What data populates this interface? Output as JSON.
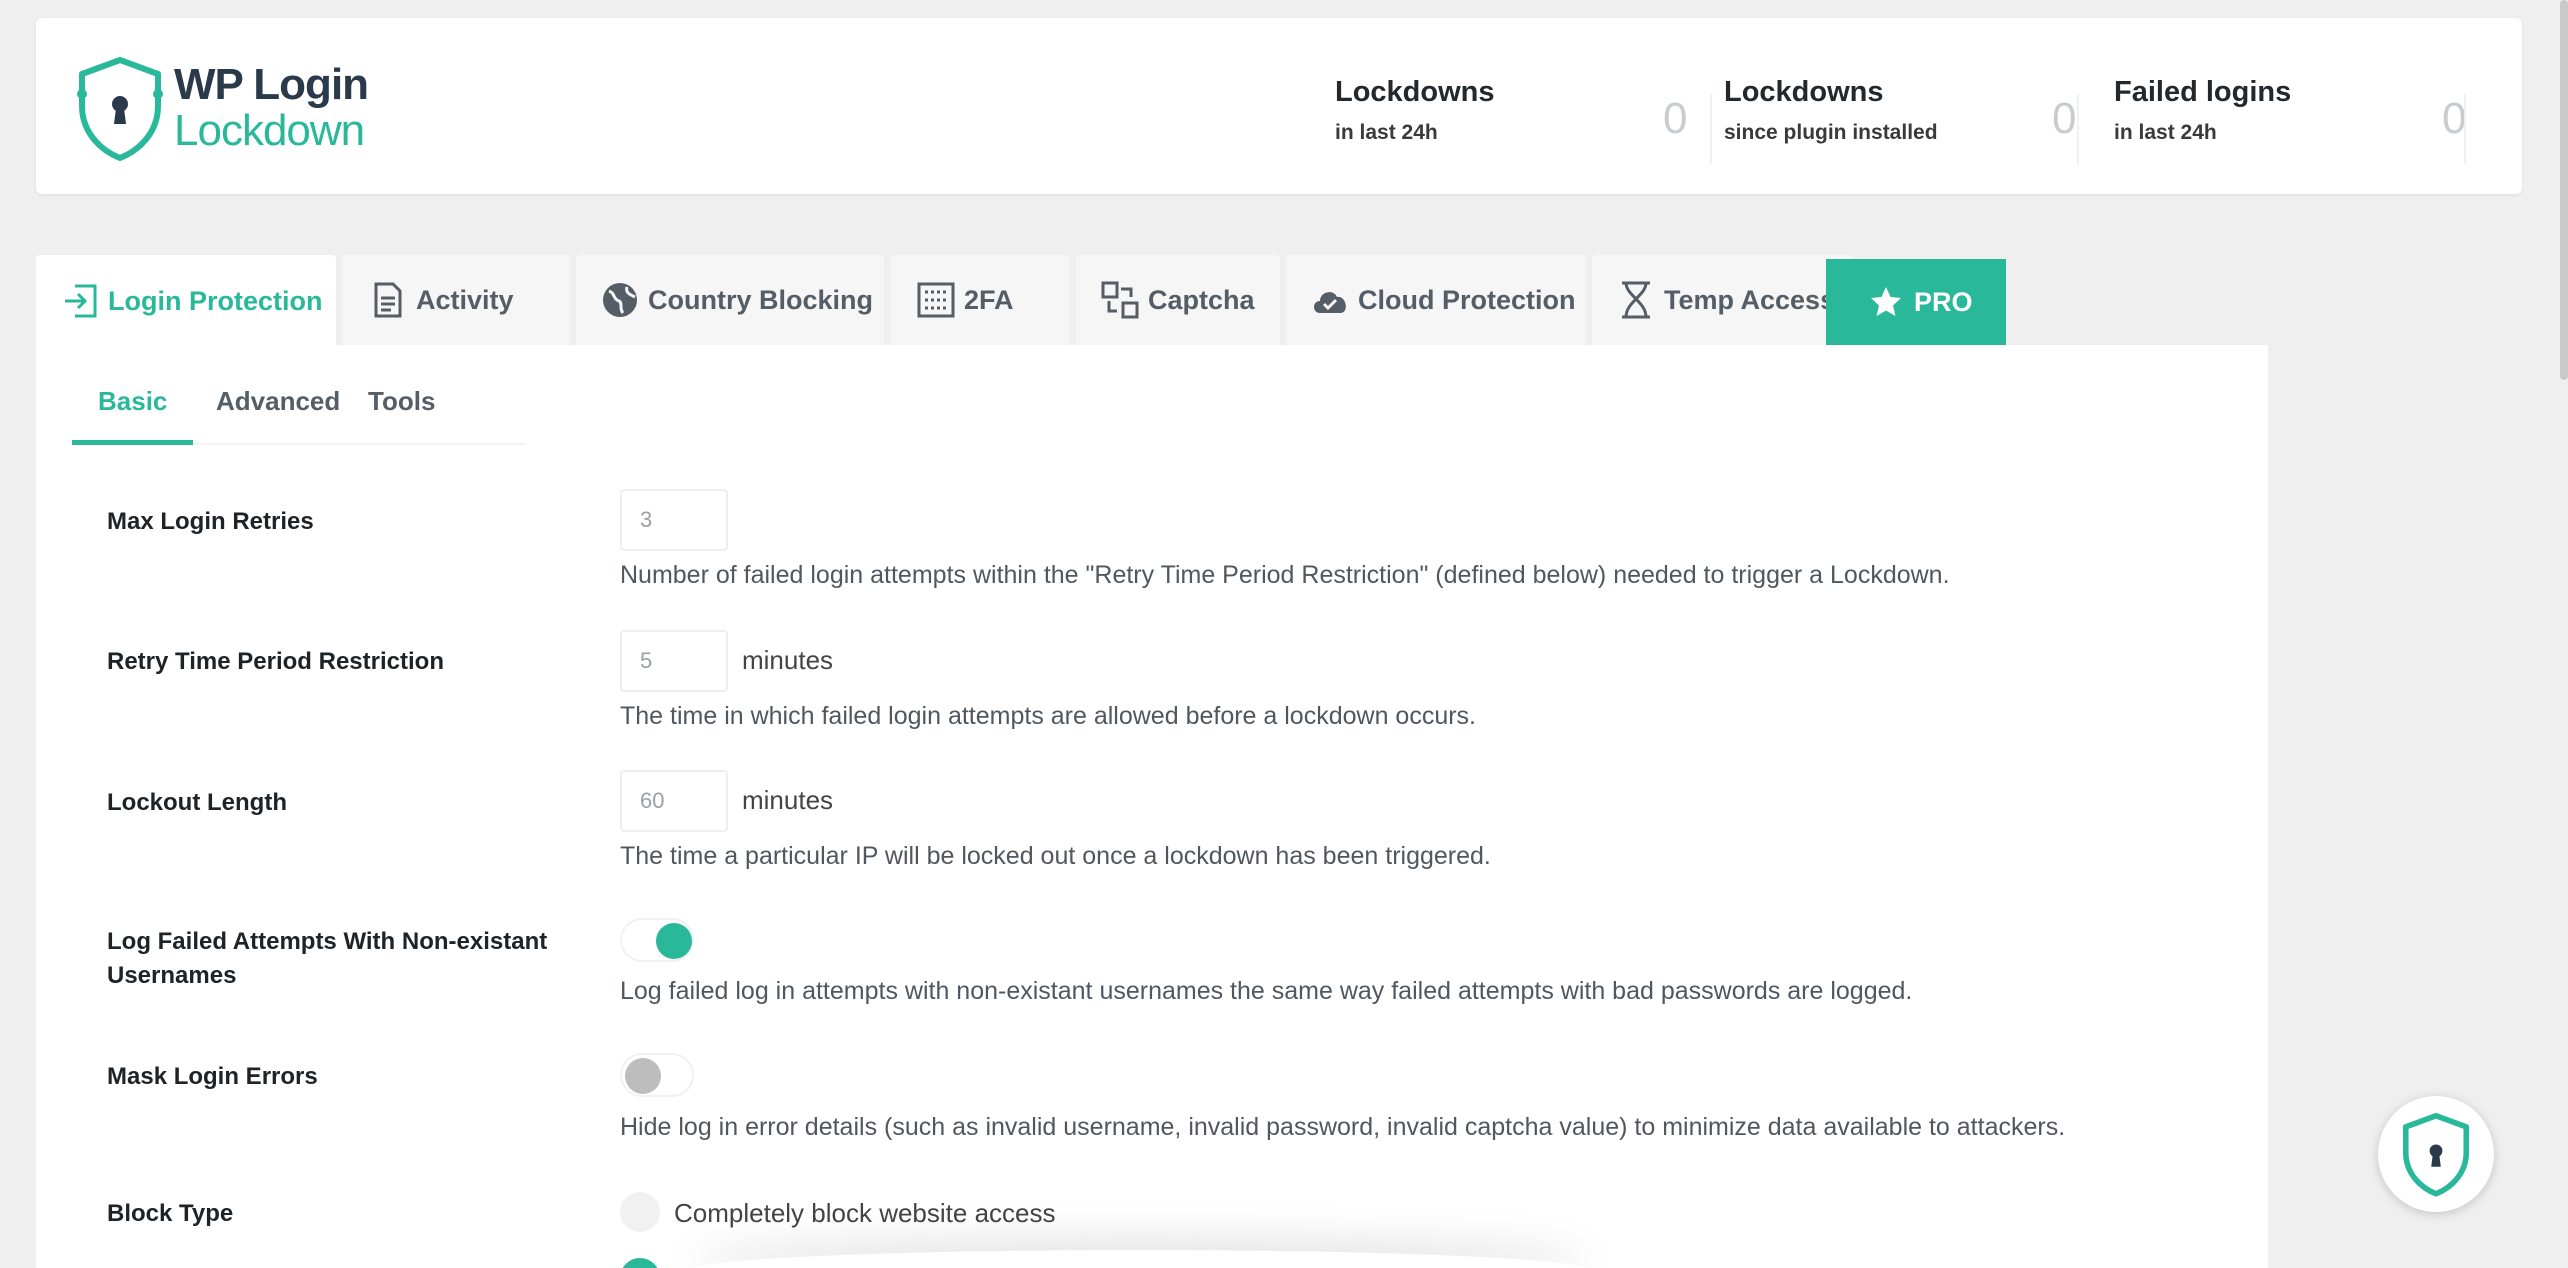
{
  "brand": {
    "line1": "WP Login",
    "line2": "Lockdown",
    "accent": "#29b99a",
    "dark": "#2b3a4a"
  },
  "stats": [
    {
      "title": "Lockdowns",
      "sub": "in last 24h",
      "value": "0"
    },
    {
      "title": "Lockdowns",
      "sub": "since plugin installed",
      "value": "0"
    },
    {
      "title": "Failed logins",
      "sub": "in last 24h",
      "value": "0"
    }
  ],
  "tabs": [
    {
      "label": "Login Protection",
      "icon": "login-icon",
      "active": true
    },
    {
      "label": "Activity",
      "icon": "document-icon"
    },
    {
      "label": "Country Blocking",
      "icon": "globe-icon"
    },
    {
      "label": "2FA",
      "icon": "keypad-icon"
    },
    {
      "label": "Captcha",
      "icon": "captcha-icon"
    },
    {
      "label": "Cloud Protection",
      "icon": "cloud-icon"
    },
    {
      "label": "Temp Access",
      "icon": "hourglass-icon"
    },
    {
      "label": "PRO",
      "icon": "star-icon"
    }
  ],
  "subtabs": [
    {
      "label": "Basic",
      "active": true
    },
    {
      "label": "Advanced"
    },
    {
      "label": "Tools"
    }
  ],
  "settings": {
    "max_retries": {
      "label": "Max Login Retries",
      "value": "3",
      "desc": "Number of failed login attempts within the \"Retry Time Period Restriction\" (defined below) needed to trigger a Lockdown."
    },
    "retry_period": {
      "label": "Retry Time Period Restriction",
      "value": "5",
      "unit": "minutes",
      "desc": "The time in which failed login attempts are allowed before a lockdown occurs."
    },
    "lockout_length": {
      "label": "Lockout Length",
      "value": "60",
      "unit": "minutes",
      "desc": "The time a particular IP will be locked out once a lockdown has been triggered."
    },
    "log_nonexistent": {
      "label_line1": "Log Failed Attempts With Non-existant",
      "label_line2": "Usernames",
      "enabled": true,
      "desc": "Log failed log in attempts with non-existant usernames the same way failed attempts with bad passwords are logged."
    },
    "mask_errors": {
      "label": "Mask Login Errors",
      "enabled": false,
      "desc": "Hide log in error details (such as invalid username, invalid password, invalid captcha value) to minimize data available to attackers."
    },
    "block_type": {
      "label": "Block Type",
      "options": [
        "Completely block website access"
      ]
    }
  }
}
